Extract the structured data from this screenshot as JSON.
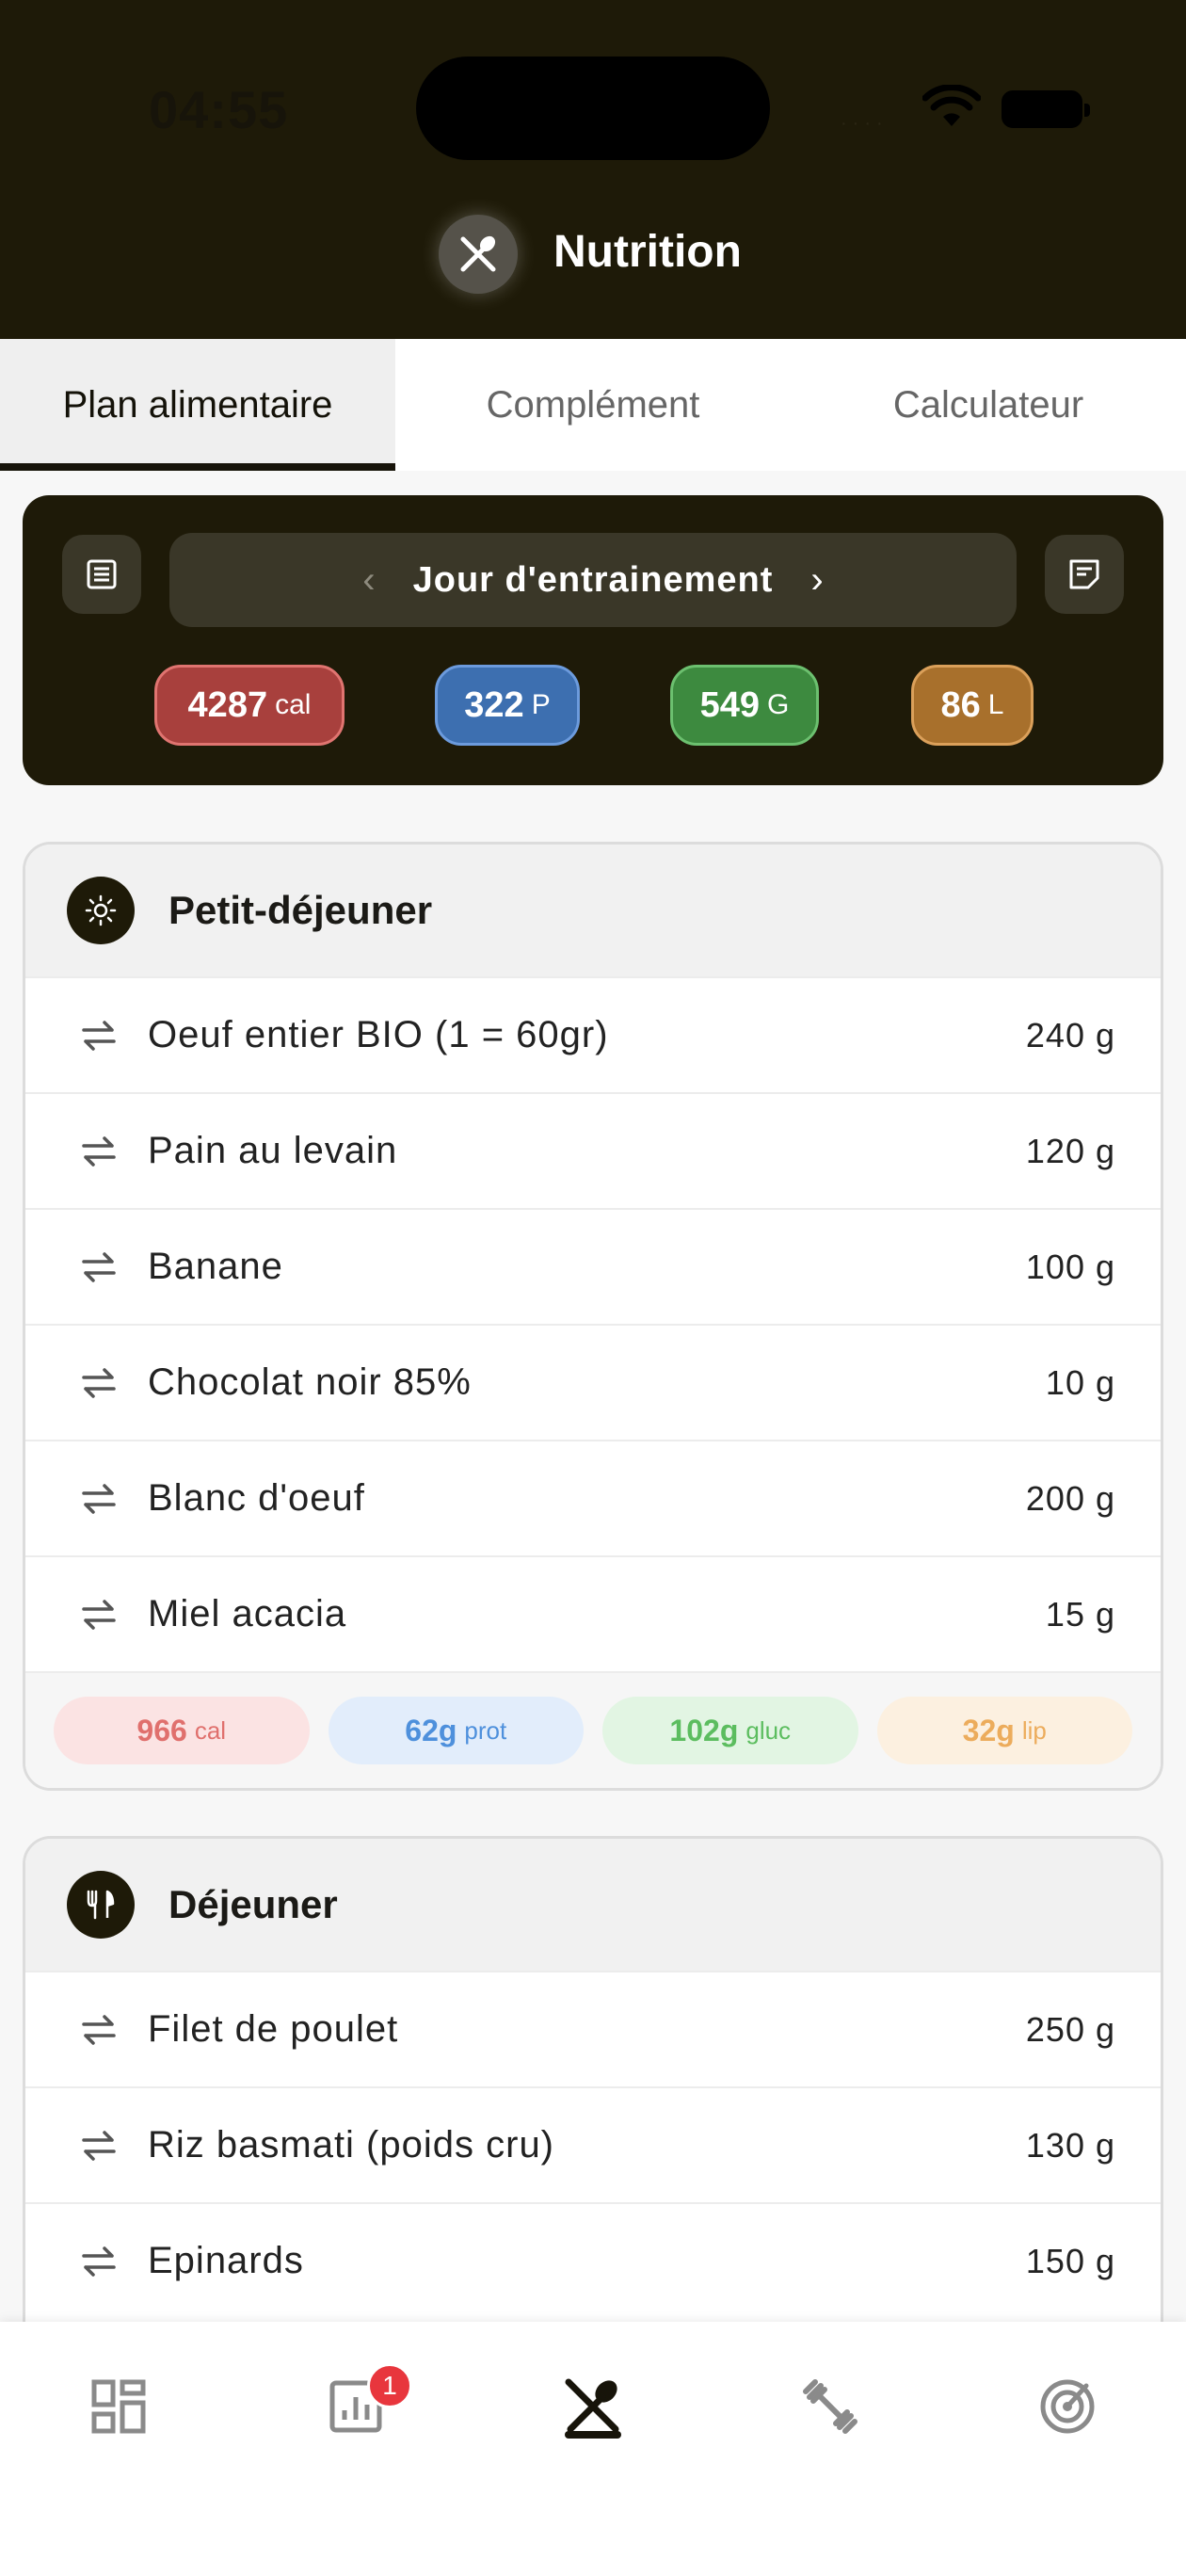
{
  "status_bar": {
    "time": "04:55",
    "dots": "····"
  },
  "header": {
    "title": "Nutrition"
  },
  "tabs": [
    {
      "label": "Plan alimentaire",
      "active": true
    },
    {
      "label": "Complément",
      "active": false
    },
    {
      "label": "Calculateur",
      "active": false
    }
  ],
  "day": {
    "label": "Jour d'entrainement",
    "prev": "‹",
    "next": "›",
    "totals": [
      {
        "value": "4287",
        "unit": "cal"
      },
      {
        "value": "322",
        "unit": "P"
      },
      {
        "value": "549",
        "unit": "G"
      },
      {
        "value": "86",
        "unit": "L"
      }
    ]
  },
  "colors": {
    "header_bg": "#1e1a08",
    "cal": "#a8403d",
    "prot": "#3d6fb0",
    "gluc": "#3d8a3f",
    "lip": "#a8702c",
    "badge": "#e8363d"
  },
  "meals": [
    {
      "title": "Petit-déjeuner",
      "icon": "sun-icon",
      "items": [
        {
          "name": "Oeuf entier BIO  (1 = 60gr)",
          "qty": "240 g"
        },
        {
          "name": "Pain au levain",
          "qty": "120 g"
        },
        {
          "name": "Banane",
          "qty": "100 g"
        },
        {
          "name": "Chocolat noir 85%",
          "qty": "10 g"
        },
        {
          "name": "Blanc d'oeuf",
          "qty": "200 g"
        },
        {
          "name": "Miel acacia",
          "qty": "15 g"
        }
      ],
      "macros": [
        {
          "value": "966",
          "unit": "cal"
        },
        {
          "value": "62g",
          "unit": "prot"
        },
        {
          "value": "102g",
          "unit": "gluc"
        },
        {
          "value": "32g",
          "unit": "lip"
        }
      ]
    },
    {
      "title": "Déjeuner",
      "icon": "utensils-icon",
      "items": [
        {
          "name": "Filet de poulet",
          "qty": "250 g"
        },
        {
          "name": "Riz basmati (poids cru)",
          "qty": "130 g"
        },
        {
          "name": "Epinards",
          "qty": "150 g"
        }
      ]
    }
  ],
  "bottom_nav": {
    "items": [
      {
        "icon": "dashboard-icon"
      },
      {
        "icon": "stats-icon",
        "badge": "1"
      },
      {
        "icon": "nutrition-icon",
        "active": true
      },
      {
        "icon": "dumbbell-icon"
      },
      {
        "icon": "target-icon"
      }
    ]
  }
}
